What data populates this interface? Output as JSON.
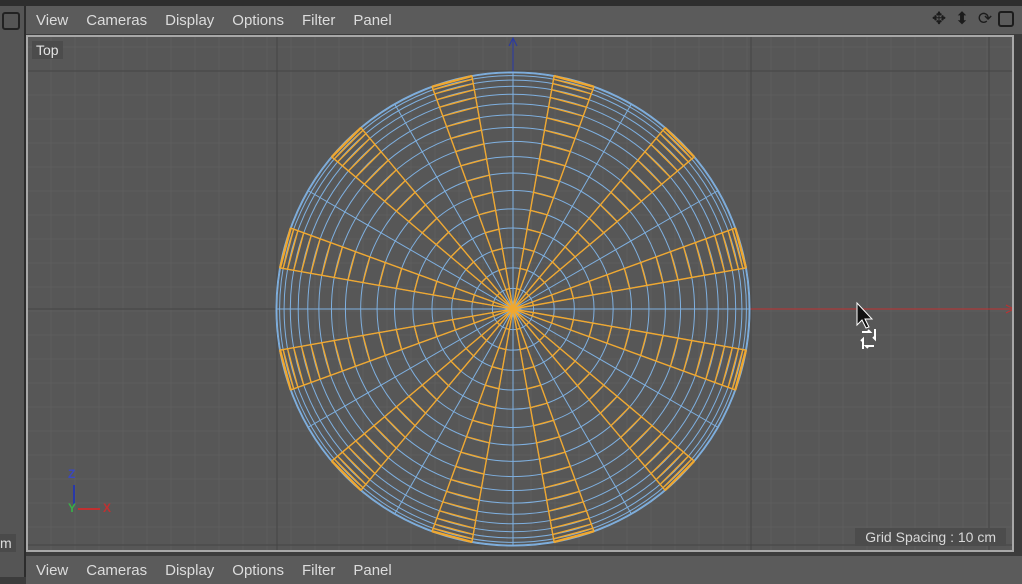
{
  "menu": [
    "View",
    "Cameras",
    "Display",
    "Options",
    "Filter",
    "Panel"
  ],
  "toolbar_icons": [
    "move-view-icon",
    "zoom-view-icon",
    "rotate-view-icon",
    "maximize-panel-icon"
  ],
  "viewport": {
    "camera_label": "Top",
    "grid_spacing": "Grid Spacing : 10 cm"
  },
  "axes": {
    "z": "Z",
    "y": "Y",
    "x": "X"
  },
  "left_pane_label": "m",
  "colors": {
    "wire": "#7fb0e0",
    "selection": "#f0a830",
    "x_axis": "#c03030",
    "z_axis": "#2838a8",
    "y_axis": "#38b048",
    "viewport_bg": "#575757"
  }
}
